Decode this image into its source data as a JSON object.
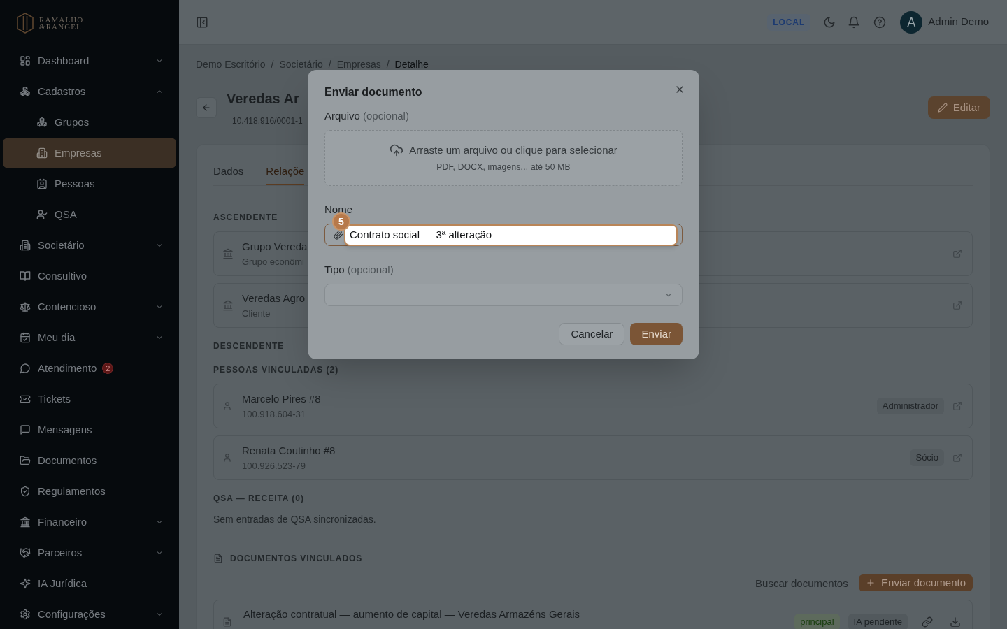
{
  "sidebar": {
    "logo": {
      "lines": [
        "RAMALHO",
        "&RANGEL"
      ]
    },
    "items": [
      {
        "label": "Dashboard",
        "kind": "group",
        "expanded": false,
        "selected": false
      },
      {
        "label": "Cadastros",
        "kind": "group",
        "expanded": true,
        "selected": false,
        "children": [
          {
            "label": "Grupos",
            "selected": false
          },
          {
            "label": "Empresas",
            "selected": true
          },
          {
            "label": "Pessoas",
            "selected": false
          },
          {
            "label": "QSA",
            "selected": false
          }
        ]
      },
      {
        "label": "Societário",
        "kind": "group",
        "expanded": false,
        "selected": false
      },
      {
        "label": "Consultivo",
        "kind": "link",
        "selected": false
      },
      {
        "label": "Contencioso",
        "kind": "group",
        "expanded": false,
        "selected": false
      },
      {
        "label": "Meu dia",
        "kind": "group",
        "expanded": false,
        "selected": false
      },
      {
        "label": "Atendimento",
        "kind": "link",
        "selected": false,
        "badge": "2"
      },
      {
        "label": "Tickets",
        "kind": "link",
        "selected": false
      },
      {
        "label": "Mensagens",
        "kind": "link",
        "selected": false
      },
      {
        "label": "Documentos",
        "kind": "link",
        "selected": false
      },
      {
        "label": "Regulamentos",
        "kind": "link",
        "selected": false
      },
      {
        "label": "Financeiro",
        "kind": "group",
        "expanded": false,
        "selected": false
      },
      {
        "label": "Parceiros",
        "kind": "group",
        "expanded": false,
        "selected": false
      },
      {
        "label": "IA Jurídica",
        "kind": "link",
        "selected": false
      },
      {
        "label": "Configurações",
        "kind": "group",
        "expanded": false,
        "selected": false
      }
    ]
  },
  "header": {
    "environment": "LOCAL",
    "user": {
      "initial": "A",
      "name": "Admin Demo"
    }
  },
  "breadcrumb": [
    {
      "label": "Demo Escritório",
      "separator": "/",
      "current": false
    },
    {
      "label": "Societário",
      "separator": "/",
      "current": false
    },
    {
      "label": "Empresas",
      "separator": "/",
      "current": false
    },
    {
      "label": "Detalhe",
      "current": true
    }
  ],
  "page": {
    "title": "Veredas Ar",
    "subtitle": "10.418.916/0001-1",
    "edit_button": "Editar"
  },
  "tabs": [
    {
      "label": "Dados",
      "selected": false
    },
    {
      "label": "Relaçõe",
      "selected": true
    }
  ],
  "sections": [
    {
      "heading": "ASCENDENTE",
      "items": [
        {
          "kind": "entity",
          "title": "Grupo Vereda",
          "subtitle": "Grupo econômi"
        },
        {
          "kind": "entity",
          "title": "Veredas Agro",
          "subtitle": "Cliente"
        }
      ]
    },
    {
      "heading": "DESCENDENTE"
    },
    {
      "heading": "PESSOAS VINCULADAS (2)",
      "items": [
        {
          "kind": "person",
          "title": "Marcelo Pires #8",
          "subtitle": "100.918.604-31",
          "role": "Administrador"
        },
        {
          "kind": "person",
          "title": "Renata Coutinho #8",
          "subtitle": "100.926.523-79",
          "role": "Sócio"
        }
      ]
    },
    {
      "heading": "QSA — RECEITA (0)",
      "empty_text": "Sem entradas de QSA sincronizadas."
    }
  ],
  "documents": {
    "heading": "DOCUMENTOS VINCULADOS",
    "search_placeholder": "Buscar documentos",
    "upload_button": "Enviar documento",
    "items": [
      {
        "title": "Alteração contratual — aumento de capital — Veredas Armazéns Gerais",
        "tags": [
          {
            "label": "principal",
            "kind": "success"
          },
          {
            "label": "IA pendente",
            "kind": "neutral"
          }
        ]
      }
    ]
  },
  "modal": {
    "title": "Enviar documento",
    "fields": [
      {
        "kind": "file",
        "label": "Arquivo",
        "hint": "(opcional)",
        "prompt": "Arraste um arquivo ou clique para selecionar",
        "note": "PDF, DOCX, imagens... até 50 MB"
      },
      {
        "kind": "text",
        "label": "Nome",
        "value": "Contrato social — 3ª alteração",
        "tour_step": "5"
      },
      {
        "kind": "select",
        "label": "Tipo",
        "hint": "(opcional)"
      }
    ],
    "buttons": [
      {
        "label": "Cancelar",
        "kind": "secondary"
      },
      {
        "label": "Enviar",
        "kind": "primary"
      }
    ]
  }
}
